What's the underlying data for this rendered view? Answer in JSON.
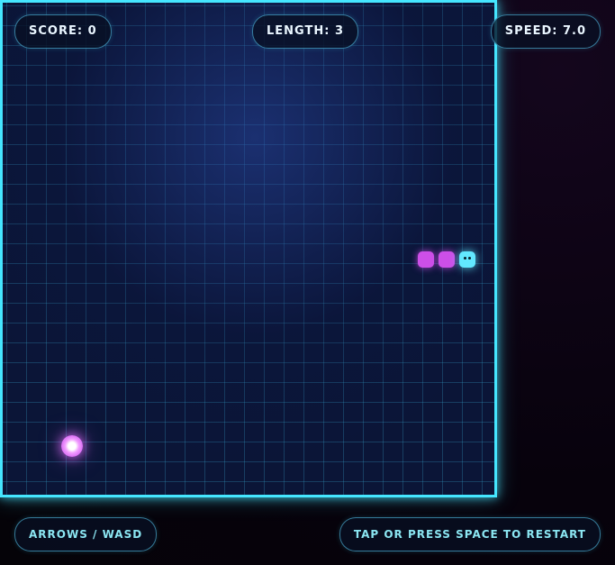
{
  "hud": {
    "score": "SCORE: 0",
    "length": "LENGTH: 3",
    "speed": "SPEED: 7.0"
  },
  "footer": {
    "controls_hint": "ARROWS / WASD",
    "restart_hint": "TAP OR PRESS SPACE TO RESTART"
  },
  "game": {
    "food_icon": "glowing-orb",
    "snake_icon": "snake",
    "colors": {
      "board_border": "#45e6ff",
      "snake_body": "#cd4fe8",
      "snake_head": "#62e8ff",
      "food": "#e46eff"
    }
  }
}
